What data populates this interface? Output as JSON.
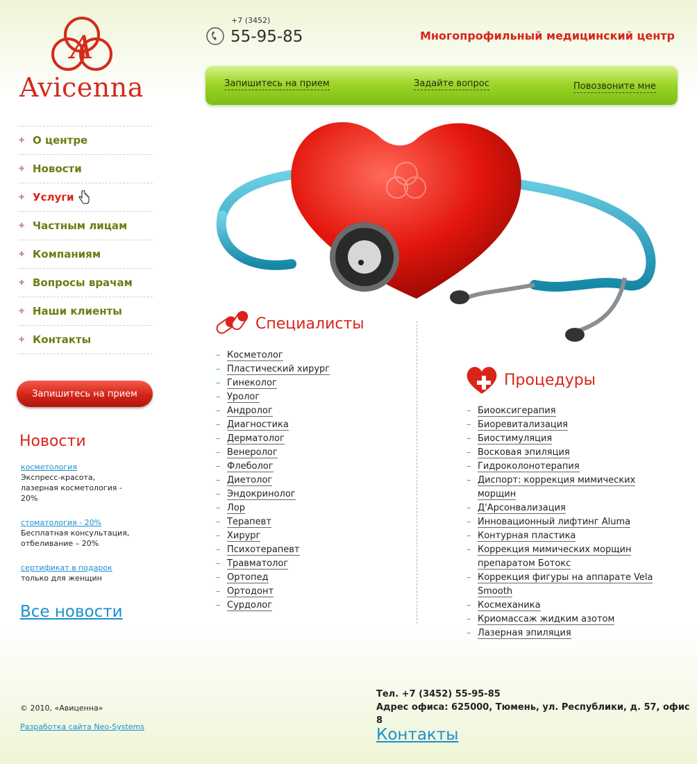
{
  "brand": {
    "name": "Avicenna",
    "logo_letter": "A",
    "accent": "#d9241a",
    "green": "#8ccb1a"
  },
  "header": {
    "phone_code": "+7 (3452)",
    "phone_number": "55-95-85",
    "tagline": "Многопрофильный медицинский центр",
    "phone_icon": "phone-icon"
  },
  "topbar": {
    "appointment": "Запишитесь на прием",
    "ask": "Задайте вопрос",
    "callback": "Повозвоните мне"
  },
  "menu": {
    "items": [
      {
        "label": "О центре"
      },
      {
        "label": "Новости"
      },
      {
        "label": "Услуги"
      },
      {
        "label": "Частным лицам"
      },
      {
        "label": "Компаниям"
      },
      {
        "label": "Вопросы врачам"
      },
      {
        "label": "Наши клиенты"
      },
      {
        "label": "Контакты"
      }
    ],
    "active_index": 2
  },
  "appointment_button": "Запишитесь на прием",
  "news": {
    "title": "Новости",
    "items": [
      {
        "link": "косметология",
        "text": "Экспресс-красота, лазерная косметология - 20%"
      },
      {
        "link": "стоматология - 20%",
        "text": "Бесплатная консультация, отбеливание – 20%"
      },
      {
        "link": "сертификат в подарок",
        "text": "только для женщин"
      }
    ],
    "all_news": "Все новости"
  },
  "specialists": {
    "title": "Специалисты",
    "icon": "pills-icon",
    "items": [
      "Косметолог",
      "Пластический хирург",
      "Гинеколог",
      "Уролог",
      "Андролог",
      "Диагностика",
      "Дерматолог",
      "Венеролог",
      "Флеболог",
      "Диетолог",
      "Эндокринолог",
      "Лор",
      "Терапевт",
      "Хирург",
      "Психотерапевт",
      "Травматолог",
      "Ортопед",
      "Ортодонт",
      "Сурдолог"
    ]
  },
  "procedures": {
    "title": "Процедуры",
    "icon": "heart-cross-icon",
    "items": [
      "Биооксигерапия",
      "Биоревитализация",
      "Биостимуляция",
      "Восковая эпиляция",
      "Гидроколонотерапия",
      "Диспорт: коррекция мимических морщин",
      "Д'Арсонвализация",
      "Инновационный лифтинг Aluma",
      "Контурная пластика",
      "Коррекция мимических морщин препаратом Ботокс",
      "Коррекция фигуры на аппарате Vela Smooth",
      "Космеханика",
      "Криомассаж жидким азотом",
      "Лазерная эпиляция"
    ]
  },
  "footer": {
    "copyright": "© 2010, «Авиценна»",
    "developer": "Разработка сайта Neo-Systems",
    "phone": "Тел. +7 (3452) 55-95-85",
    "address": "Адрес офиса: 625000, Тюмень, ул. Республики, д. 57, офис 8",
    "contacts_link": "Контакты"
  }
}
